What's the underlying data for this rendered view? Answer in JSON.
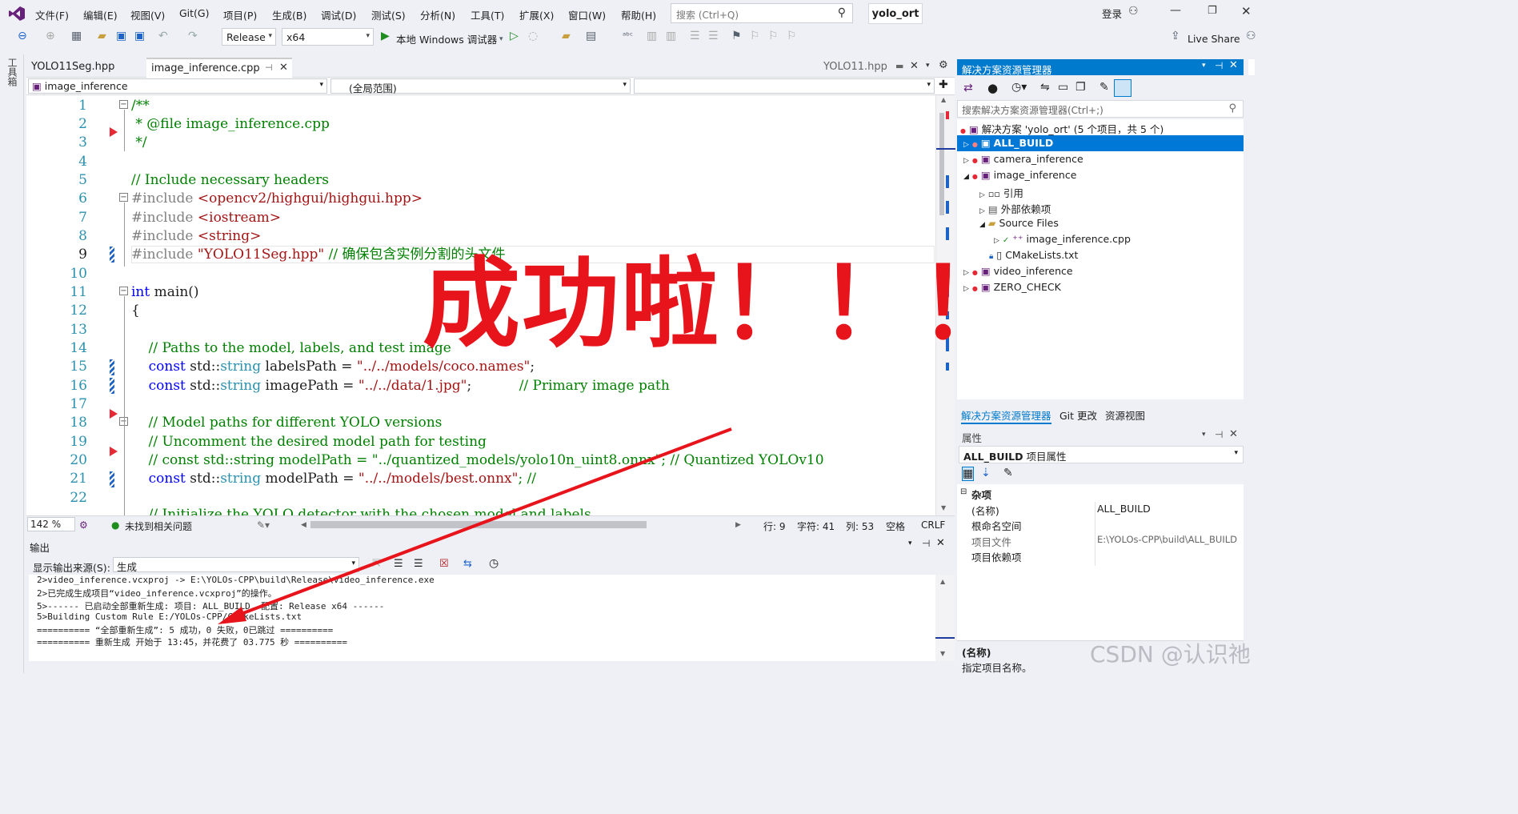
{
  "menu": [
    "文件(F)",
    "编辑(E)",
    "视图(V)",
    "Git(G)",
    "项目(P)",
    "生成(B)",
    "调试(D)",
    "测试(S)",
    "分析(N)",
    "工具(T)",
    "扩展(X)",
    "窗口(W)",
    "帮助(H)"
  ],
  "search": {
    "placeholder": "搜索 (Ctrl+Q)"
  },
  "solution_badge": "yolo_ort",
  "account": {
    "login": "登录",
    "live_share": "Live Share"
  },
  "toolbar": {
    "config": "Release",
    "platform": "x64",
    "debugger": "本地 Windows 调试器"
  },
  "left_rail_label": "工具箱",
  "tabs": {
    "tab1": "YOLO11Seg.hpp",
    "tab2": "image_inference.cpp",
    "right_tab": "YOLO11.hpp"
  },
  "nav": {
    "project": "image_inference",
    "scope": "(全局范围)"
  },
  "code_lines": [
    "1",
    "2",
    "3",
    "4",
    "5",
    "6",
    "7",
    "8",
    "9",
    "10",
    "11",
    "12",
    "13",
    "14",
    "15",
    "16",
    "17",
    "18",
    "19",
    "20",
    "21",
    "22"
  ],
  "code": {
    "l1": "/**",
    "l2": " * @file image_inference.cpp",
    "l3": " */",
    "l5": "// Include necessary headers",
    "l6a": "#include ",
    "l6b": "<opencv2/highgui/highgui.hpp>",
    "l7a": "#include ",
    "l7b": "<iostream>",
    "l8a": "#include ",
    "l8b": "<string>",
    "l9a": "#include ",
    "l9b": "\"YOLO11Seg.hpp\"",
    "l9c": " // 确保包含实例分割的头文件",
    "l11a": "int",
    "l11b": " main()",
    "l12": "{",
    "l14": "    // Paths to the model, labels, and test image",
    "l15a": "    const",
    "l15b": " std::",
    "l15c": "string",
    "l15d": " labelsPath = ",
    "l15e": "\"../../models/coco.names\"",
    "l15f": ";",
    "l16a": "    const",
    "l16b": " std::",
    "l16c": "string",
    "l16d": " imagePath = ",
    "l16e": "\"../../data/1.jpg\"",
    "l16f": ";",
    "l16g": "           // Primary image path",
    "l18": "    // Model paths for different YOLO versions",
    "l19": "    // Uncomment the desired model path for testing",
    "l20": "    // const std::string modelPath = \"../quantized_models/yolo10n_uint8.onnx\"; // Quantized YOLOv10",
    "l21a": "    const",
    "l21b": " std::",
    "l21c": "string",
    "l21d": " modelPath = ",
    "l21e": "\"../../models/best.onnx\"",
    "l21f": "; //",
    "l22": "    // Initialize the YOLO detector with the chosen model and labels"
  },
  "status": {
    "zoom": "142 %",
    "issues": "未找到相关问题",
    "line": "行: 9",
    "char": "字符: 41",
    "col": "列: 53",
    "spaces": "空格",
    "eol": "CRLF"
  },
  "output": {
    "title": "输出",
    "source_label": "显示输出来源(S):",
    "source_value": "生成",
    "lines": [
      "2>video_inference.vcxproj -> E:\\YOLOs-CPP\\build\\Release\\video_inference.exe",
      "2>已完成生成项目“video_inference.vcxproj”的操作。",
      "5>------ 已启动全部重新生成: 项目: ALL_BUILD, 配置: Release x64 ------",
      "5>Building Custom Rule E:/YOLOs-CPP/CMakeLists.txt",
      "========== “全部重新生成”: 5 成功，0 失败，0已跳过 ==========",
      "========== 重新生成 开始于 13:45，并花费了 03.775 秒 =========="
    ]
  },
  "solution_explorer": {
    "title": "解决方案资源管理器",
    "search_placeholder": "搜索解决方案资源管理器(Ctrl+;)",
    "tree": [
      {
        "label": "解决方案 'yolo_ort' (5 个项目，共 5 个)"
      },
      {
        "label": "ALL_BUILD"
      },
      {
        "label": "camera_inference"
      },
      {
        "label": "image_inference"
      },
      {
        "label": "引用"
      },
      {
        "label": "外部依赖项"
      },
      {
        "label": "Source Files"
      },
      {
        "label": "image_inference.cpp"
      },
      {
        "label": "CMakeLists.txt"
      },
      {
        "label": "video_inference"
      },
      {
        "label": "ZERO_CHECK"
      }
    ],
    "bottom_tabs": [
      "解决方案资源管理器",
      "Git 更改",
      "资源视图"
    ]
  },
  "properties": {
    "title": "属性",
    "object": "ALL_BUILD",
    "object_suffix": "项目属性",
    "category": "杂项",
    "rows": [
      {
        "name": "(名称)",
        "value": "ALL_BUILD"
      },
      {
        "name": "根命名空间",
        "value": ""
      },
      {
        "name": "项目文件",
        "value": "E:\\YOLOs-CPP\\build\\ALL_BUILD"
      },
      {
        "name": "项目依赖项",
        "value": ""
      }
    ],
    "desc_title": "(名称)",
    "desc_text": "指定项目名称。"
  },
  "annotation": {
    "text": "成功啦！！！",
    "color": "#e8141c"
  },
  "watermark": "CSDN @认识祂",
  "colors": {
    "accent": "#007acc",
    "vs_purple": "#68217a",
    "run_green": "#1e8c1e"
  }
}
